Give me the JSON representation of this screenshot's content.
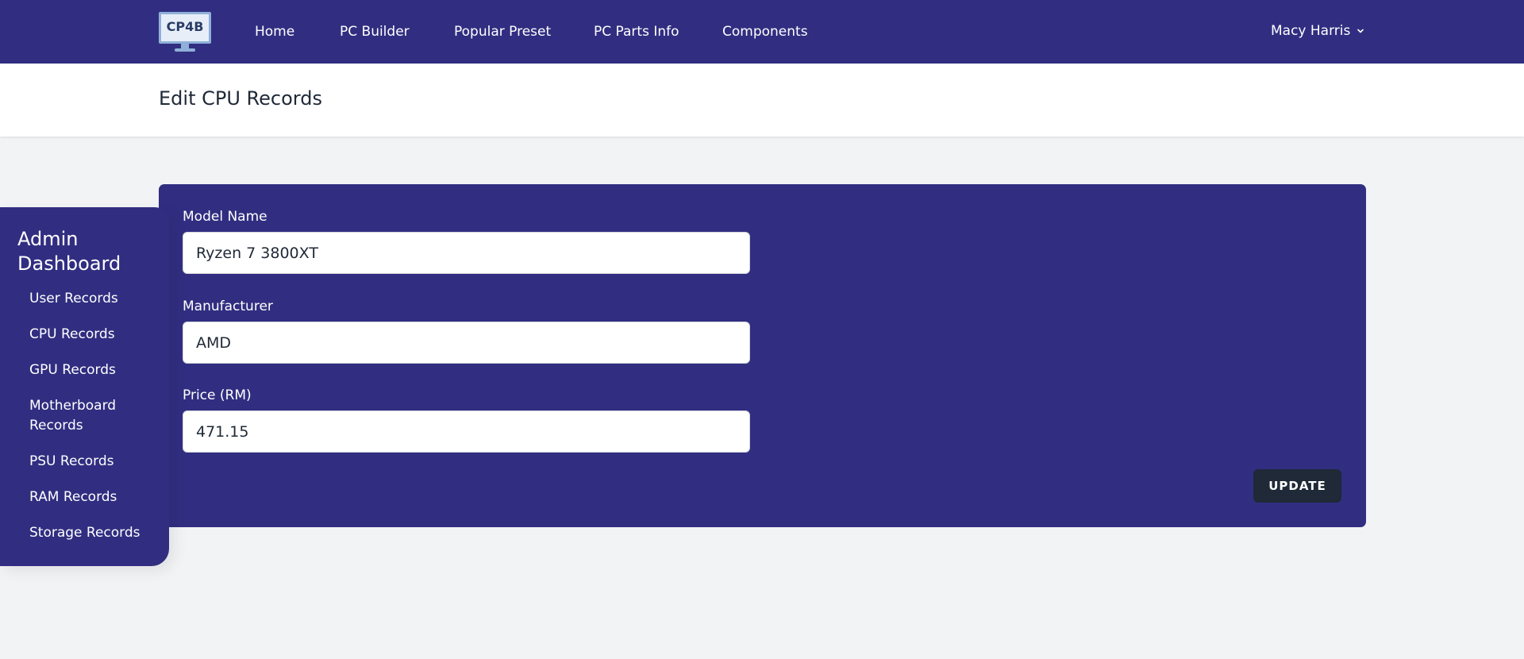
{
  "nav": {
    "logo_text": "CP4B",
    "links": [
      "Home",
      "PC Builder",
      "Popular Preset",
      "PC Parts Info",
      "Components"
    ],
    "user_name": "Macy Harris"
  },
  "header": {
    "title": "Edit CPU Records"
  },
  "sidebar": {
    "title": "Admin Dashboard",
    "items": [
      {
        "label": "User Records"
      },
      {
        "label": "CPU Records"
      },
      {
        "label": "GPU Records"
      },
      {
        "label": "Motherboard Records"
      },
      {
        "label": "PSU Records"
      },
      {
        "label": "RAM Records"
      },
      {
        "label": "Storage Records"
      }
    ]
  },
  "form": {
    "model_name": {
      "label": "Model Name",
      "value": "Ryzen 7 3800XT"
    },
    "manufacturer": {
      "label": "Manufacturer",
      "value": "AMD"
    },
    "price": {
      "label": "Price (RM)",
      "value": "471.15"
    },
    "submit_label": "UPDATE"
  },
  "colors": {
    "brand": "#312e81",
    "page_bg": "#f2f3f5",
    "button": "#1f2937"
  }
}
